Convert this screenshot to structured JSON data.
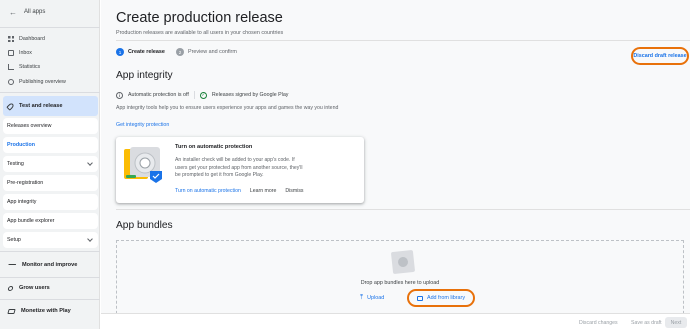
{
  "sidebar": {
    "all_apps": "All apps",
    "nav": {
      "dashboard": "Dashboard",
      "inbox": "Inbox",
      "statistics": "Statistics",
      "publishing": "Publishing overview"
    },
    "sections": {
      "test_release": "Test and release",
      "monitor": "Monitor and improve",
      "grow": "Grow users",
      "monetize": "Monetize with Play"
    },
    "sub_items": {
      "releases_overview": "Releases overview",
      "production": "Production",
      "testing": "Testing",
      "pre_registration": "Pre-registration",
      "app_integrity": "App integrity",
      "bundle_explorer": "App bundle explorer",
      "setup": "Setup"
    }
  },
  "main": {
    "title": "Create production release",
    "subtitle": "Production releases are available to all users in your chosen countries",
    "steps": [
      {
        "num": "1",
        "label": "Create release"
      },
      {
        "num": "2",
        "label": "Preview and confirm"
      }
    ],
    "discard_label": "Discard draft release",
    "integrity": {
      "heading": "App integrity",
      "protection_status": "Automatic protection is off",
      "signing_status": "Releases signed by Google Play",
      "description": "App integrity tools help you to ensure users experience your apps and games the way you intend",
      "get_protection": "Get integrity protection",
      "card": {
        "title": "Turn on automatic protection",
        "body": "An installer check will be added to your app's code. If users get your protected app from another source, they'll be prompted to get it from Google Play.",
        "primary_action": "Turn on automatic protection",
        "learn_more": "Learn more",
        "dismiss": "Dismiss"
      }
    },
    "bundles": {
      "heading": "App bundles",
      "drop_text": "Drop app bundles here to upload",
      "upload": "Upload",
      "add_library": "Add from library"
    }
  },
  "footer": {
    "discard_changes": "Discard changes",
    "save_draft": "Save as draft",
    "next": "Next"
  },
  "colors": {
    "accent": "#1a73e8",
    "highlight": "#e8710a",
    "success": "#188038",
    "selected_bg": "#d2e3fc"
  }
}
